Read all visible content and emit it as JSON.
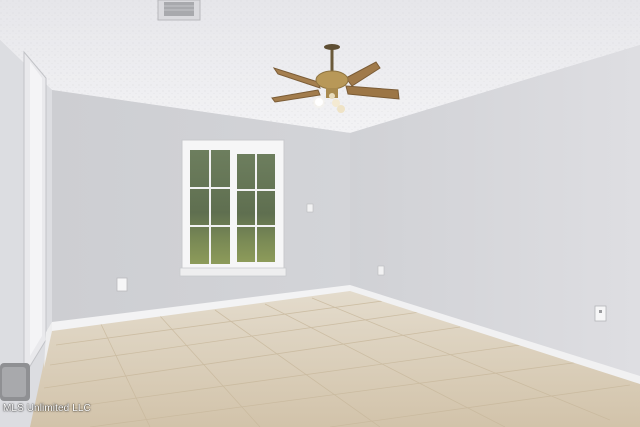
{
  "photo": {
    "subject": "empty-room-with-ceiling-fan",
    "watermark": "MLS Unlimited LLC"
  },
  "colors": {
    "ceiling": "#ececef",
    "wall_left": "#d4d5d9",
    "wall_back": "#cfd0d4",
    "wall_right": "#d9d9dd",
    "floor": "#d9cdb8",
    "baseboard": "#f2f2f2",
    "fan_blade": "#a07a4a",
    "fan_brass": "#b89858"
  }
}
